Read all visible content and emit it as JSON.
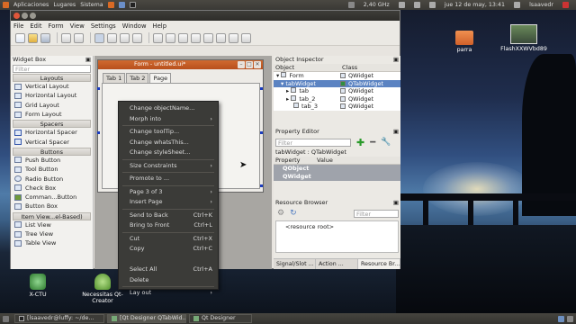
{
  "top_panel": {
    "menus": [
      "Aplicaciones",
      "Lugares",
      "Sistema"
    ],
    "network": "2,40 GHz",
    "datetime": "jue 12 de may, 13:41",
    "user": "lsaavedr"
  },
  "designer": {
    "menu": [
      "File",
      "Edit",
      "Form",
      "View",
      "Settings",
      "Window",
      "Help"
    ]
  },
  "widget_box": {
    "title": "Widget Box",
    "filter_placeholder": "Filter",
    "layouts_header": "Layouts",
    "layouts": [
      "Vertical Layout",
      "Horizontal Layout",
      "Grid Layout",
      "Form Layout"
    ],
    "spacers_header": "Spacers",
    "spacers": [
      "Horizontal Spacer",
      "Vertical Spacer"
    ],
    "buttons_header": "Buttons",
    "buttons": [
      "Push Button",
      "Tool Button",
      "Radio Button",
      "Check Box",
      "Comman...Button",
      "Button Box"
    ],
    "itemviews_header": "Item View...el-Based)",
    "itemviews": [
      "List View",
      "Tree View",
      "Table View"
    ]
  },
  "form": {
    "title": "Form - untitled.ui*",
    "tabs": [
      "Tab 1",
      "Tab 2",
      "Page"
    ]
  },
  "object_inspector": {
    "title": "Object Inspector",
    "col_object": "Object",
    "col_class": "Class",
    "rows": [
      {
        "object": "Form",
        "class": "QWidget"
      },
      {
        "object": "tabWidget",
        "class": "QTabWidget"
      },
      {
        "object": "tab",
        "class": "QWidget"
      },
      {
        "object": "tab_2",
        "class": "QWidget"
      },
      {
        "object": "tab_3",
        "class": "QWidget"
      }
    ]
  },
  "property_editor": {
    "title": "Property Editor",
    "filter_placeholder": "Filter",
    "context": "tabWidget : QTabWidget",
    "col_property": "Property",
    "col_value": "Value",
    "groups": [
      "QObject",
      "QWidget"
    ]
  },
  "resource_browser": {
    "title": "Resource Browser",
    "filter_placeholder": "Filter",
    "root": "<resource root>",
    "tabs": [
      "Signal/Slot ...",
      "Action ...",
      "Resource Br..."
    ]
  },
  "context_menu": {
    "change_object_name": "Change objectName...",
    "morph_into": "Morph into",
    "change_tooltip": "Change toolTip...",
    "change_whatsthis": "Change whatsThis...",
    "change_stylesheet": "Change styleSheet...",
    "size_constraints": "Size Constraints",
    "promote_to": "Promote to ...",
    "page_of": "Page 3 of 3",
    "insert_page": "Insert Page",
    "send_to_back": "Send to Back",
    "send_to_back_sc": "Ctrl+K",
    "bring_to_front": "Bring to Front",
    "bring_to_front_sc": "Ctrl+L",
    "cut": "Cut",
    "cut_sc": "Ctrl+X",
    "copy": "Copy",
    "copy_sc": "Ctrl+C",
    "select_all": "Select All",
    "select_all_sc": "Ctrl+A",
    "delete": "Delete",
    "layout": "Lay out"
  },
  "desktop": {
    "icons": [
      "parra",
      "FlashXXWVbd89",
      "X-CTU",
      "Necessitas Qt-Creator"
    ]
  },
  "taskbar": {
    "items": [
      "[lsaavedr@luffy: ~/de...",
      "[Qt Designer  QTabWid...",
      "Qt Designer"
    ]
  }
}
